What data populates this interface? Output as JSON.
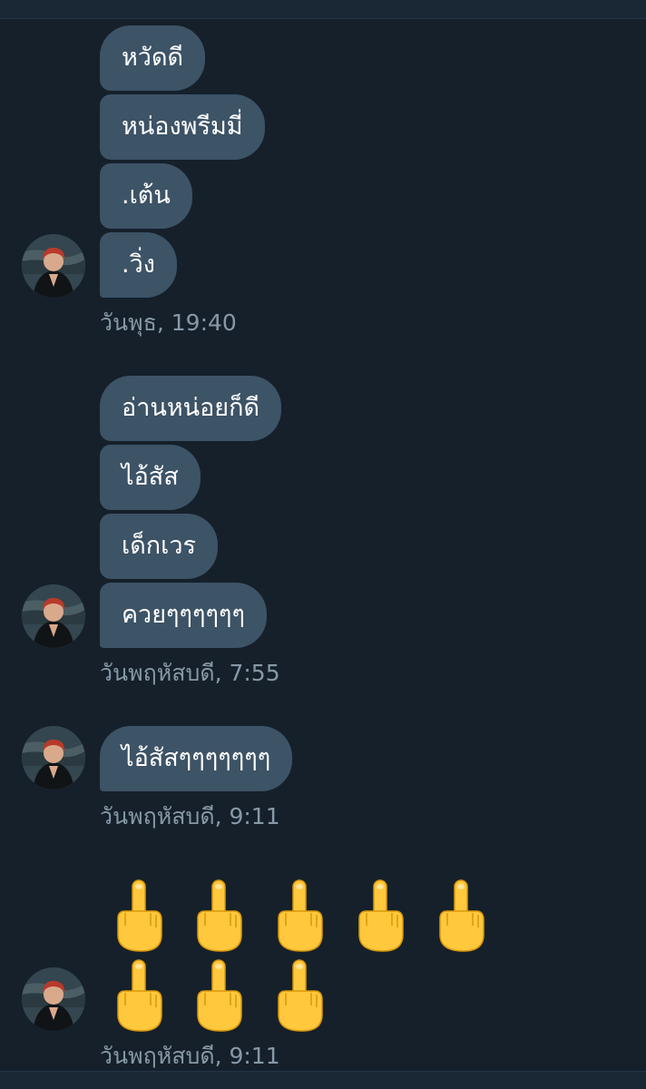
{
  "groups": [
    {
      "messages": [
        "หวัดดี",
        "หน่องพรีมมี่",
        ".เต้น",
        ".วิ่ง"
      ],
      "timestamp": "วันพุธ, 19:40"
    },
    {
      "messages": [
        "อ่านหน่อยก็ดี",
        "ไอ้สัส",
        "เด็กเวร",
        "ควยๆๆๆๆๆๆ"
      ],
      "timestamp": "วันพฤหัสบดี, 7:55"
    },
    {
      "messages": [
        "ไอ้สัสๆๆๆๆๆๆๆ"
      ],
      "timestamp": "วันพฤหัสบดี, 9:11"
    },
    {
      "emoji_message": {
        "emoji": "middle-finger-emoji",
        "count": 8
      },
      "timestamp": "วันพฤหัสบดี, 9:11"
    }
  ],
  "colors": {
    "background": "#15202b",
    "bubble": "#3d5366",
    "bubble_text": "#ffffff",
    "timestamp": "#8899a6",
    "emoji_fill": "#ffc83d"
  }
}
